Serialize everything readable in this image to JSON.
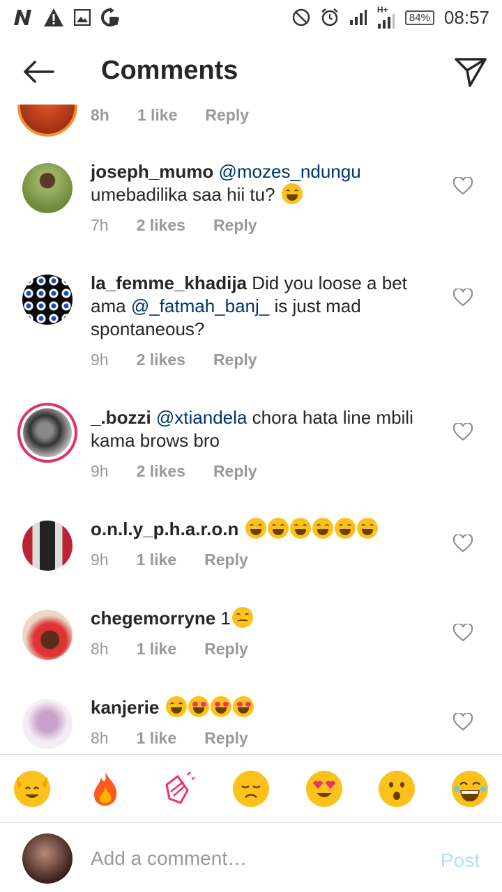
{
  "status_bar": {
    "battery": "84%",
    "time": "08:57",
    "network": "H+"
  },
  "header": {
    "title": "Comments"
  },
  "partial_comment": {
    "time": "8h",
    "likes": "1 like",
    "reply": "Reply"
  },
  "comments": [
    {
      "username": "joseph_mumo",
      "mention": "@mozes_ndungu",
      "text": "umebadilika saa hii tu?",
      "time": "7h",
      "likes": "2 likes",
      "reply": "Reply"
    },
    {
      "username": "la_femme_khadija",
      "text_before": "Did you loose a bet ama",
      "mention": "@_fatmah_banj_",
      "text": "is just mad spontaneous?",
      "time": "9h",
      "likes": "2 likes",
      "reply": "Reply"
    },
    {
      "username": "_.bozzi",
      "mention": "@xtiandela",
      "text": "chora hata line mbili kama brows bro",
      "time": "9h",
      "likes": "2 likes",
      "reply": "Reply"
    },
    {
      "username": "o.n.l.y_p.h.a.r.o.n",
      "text": "",
      "time": "9h",
      "likes": "1 like",
      "reply": "Reply"
    },
    {
      "username": "chegemorryne",
      "text": "1",
      "time": "8h",
      "likes": "1 like",
      "reply": "Reply"
    },
    {
      "username": "kanjerie",
      "text": "",
      "time": "8h",
      "likes": "1 like",
      "reply": "Reply"
    }
  ],
  "quick_emojis": [
    "raising-hands",
    "fire",
    "clapping-hands",
    "sad-face",
    "heart-eyes",
    "surprised-face",
    "laughing-face"
  ],
  "input": {
    "placeholder": "Add a comment…",
    "post_label": "Post"
  },
  "colors": {
    "mention": "#003569",
    "meta": "#999999",
    "post_disabled": "#b2dffc",
    "story_ring": "#e1306c"
  }
}
